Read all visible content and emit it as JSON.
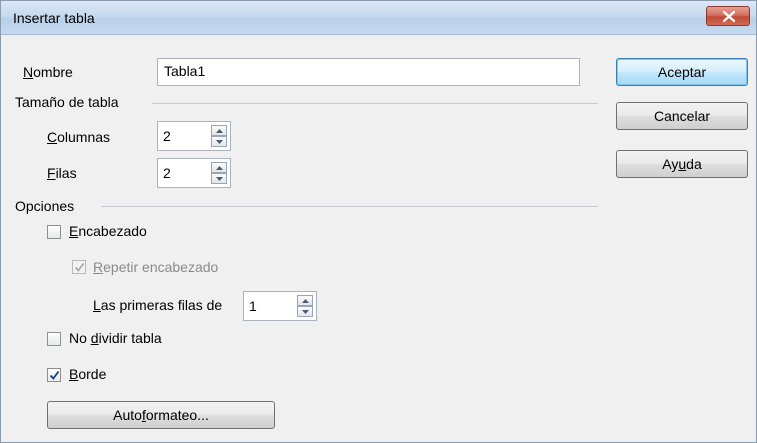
{
  "window": {
    "title": "Insertar tabla"
  },
  "name_field": {
    "label_u": "N",
    "label_rest": "ombre",
    "value": "Tabla1"
  },
  "size_section": {
    "title": "Tamaño de tabla"
  },
  "columns": {
    "label_u": "C",
    "label_rest": "olumnas",
    "value": "2"
  },
  "rows": {
    "label_u": "F",
    "label_rest": "ilas",
    "value": "2"
  },
  "options_section": {
    "title": "Opciones"
  },
  "heading": {
    "label_u": "E",
    "label_rest": "ncabezado",
    "checked": false
  },
  "repeat_heading": {
    "label_u": "R",
    "label_rest": "epetir encabezado",
    "checked": true,
    "disabled": true
  },
  "first_rows": {
    "label_u": "L",
    "label_rest": "as primeras filas de",
    "value": "1"
  },
  "no_split": {
    "label_pre": "No ",
    "label_u": "d",
    "label_rest": "ividir tabla",
    "checked": false
  },
  "border": {
    "label_u": "B",
    "label_rest": "orde",
    "checked": true
  },
  "buttons": {
    "autoformat_pre": "Auto",
    "autoformat_u": "f",
    "autoformat_rest": "ormateo...",
    "ok": "Aceptar",
    "cancel": "Cancelar",
    "help_pre": "Ay",
    "help_u": "u",
    "help_rest": "da"
  }
}
